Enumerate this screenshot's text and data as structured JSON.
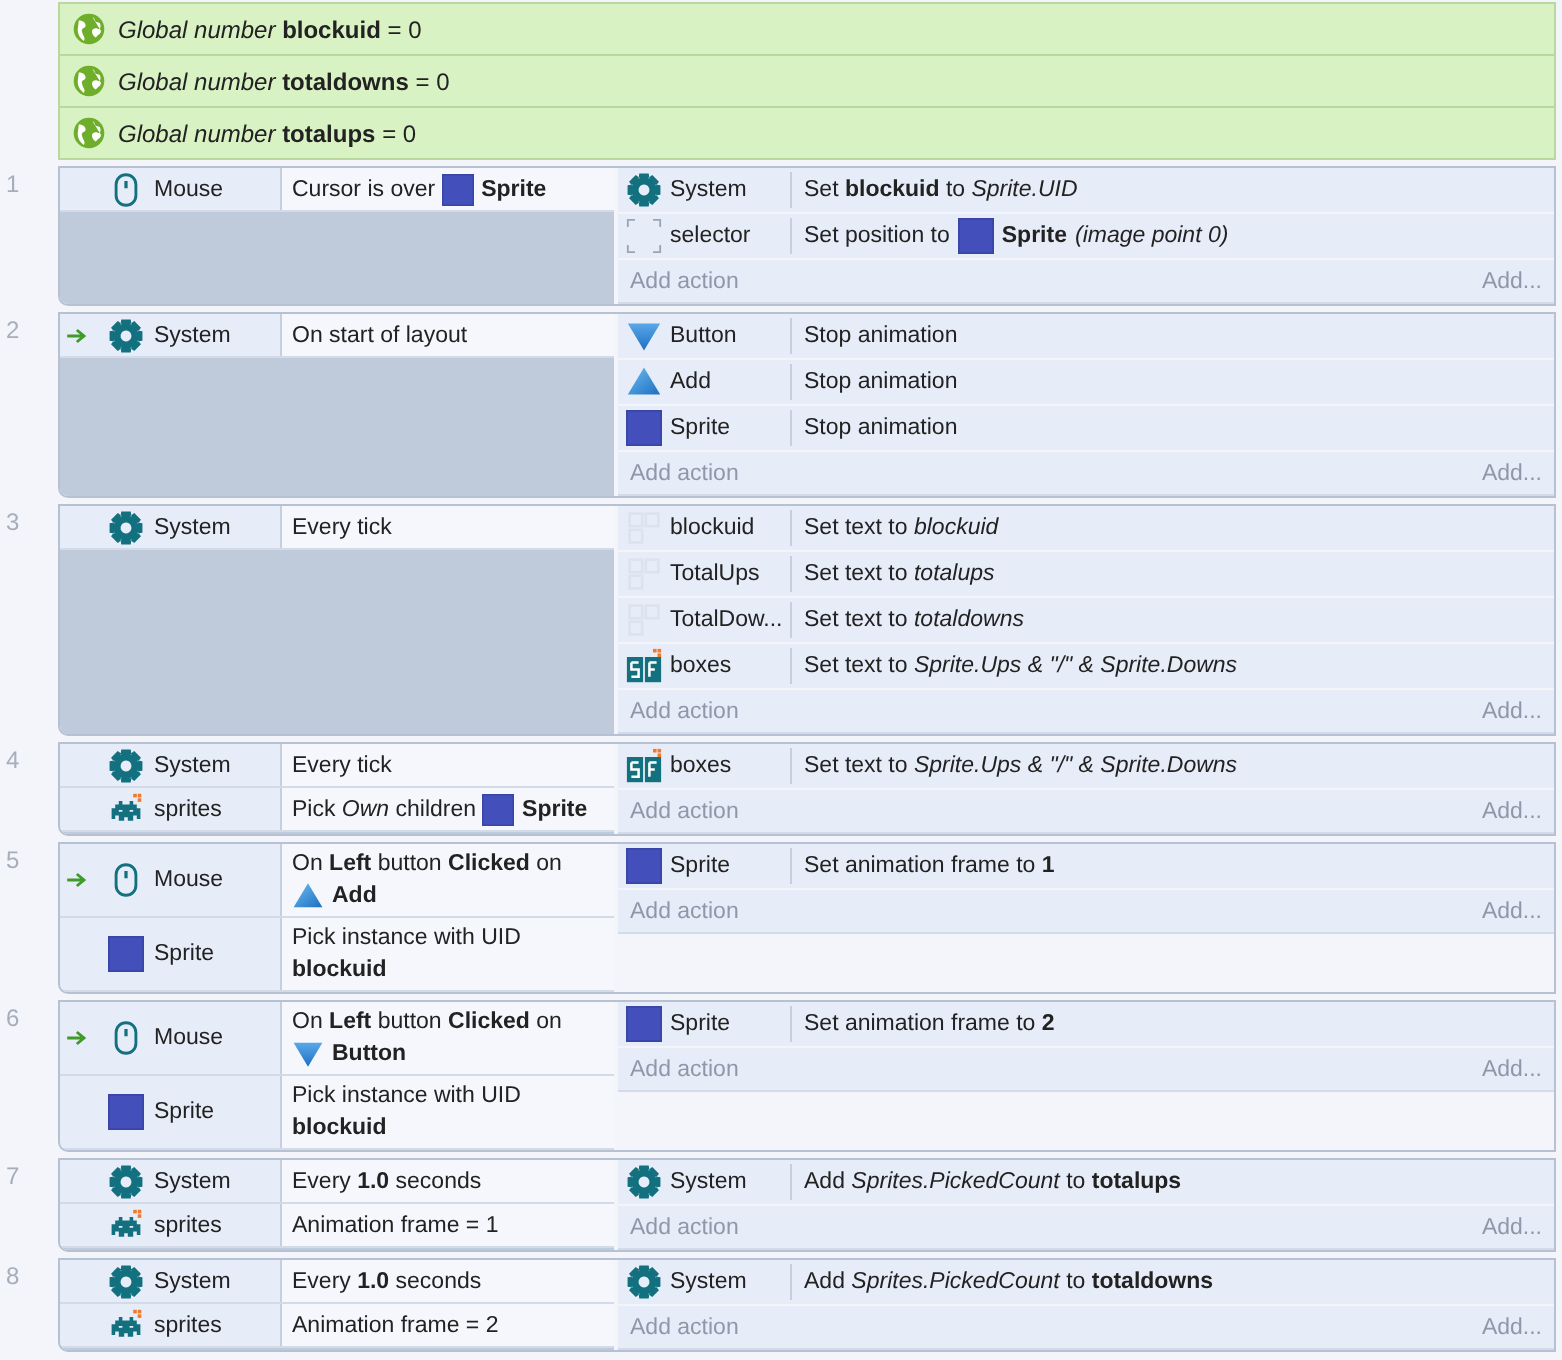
{
  "globals": [
    {
      "text": "*Global number* **blockuid** = 0"
    },
    {
      "text": "*Global number* **totaldowns** = 0"
    },
    {
      "text": "*Global number* **totalups** = 0"
    }
  ],
  "events": [
    {
      "number": "1",
      "trigger": false,
      "conditions": [
        {
          "kind": "mouse",
          "object": "Mouse",
          "text": "Cursor is over",
          "target": {
            "kind": "sprite",
            "name": "Sprite"
          }
        }
      ],
      "actions": [
        {
          "kind": "gear",
          "object": "System",
          "text": "Set **blockuid** to *Sprite.UID*"
        },
        {
          "kind": "selector",
          "object": "selector",
          "text": "Set position to",
          "target": {
            "kind": "sprite",
            "name": "Sprite"
          },
          "suffix": "*(image point 0)*"
        }
      ],
      "add_action": "Add action",
      "add_more": "Add..."
    },
    {
      "number": "2",
      "trigger": true,
      "conditions": [
        {
          "kind": "gear",
          "object": "System",
          "text": "On start of layout"
        }
      ],
      "actions": [
        {
          "kind": "button",
          "object": "Button",
          "text": "Stop animation"
        },
        {
          "kind": "add",
          "object": "Add",
          "text": "Stop animation"
        },
        {
          "kind": "sprite",
          "object": "Sprite",
          "text": "Stop animation"
        }
      ],
      "add_action": "Add action",
      "add_more": "Add..."
    },
    {
      "number": "3",
      "trigger": false,
      "conditions": [
        {
          "kind": "gear",
          "object": "System",
          "text": "Every tick"
        }
      ],
      "actions": [
        {
          "kind": "text",
          "object": "blockuid",
          "text": "Set text to *blockuid*"
        },
        {
          "kind": "text",
          "object": "TotalUps",
          "text": "Set text to *totalups*"
        },
        {
          "kind": "text",
          "object": "TotalDow...",
          "text": "Set text to *totaldowns*"
        },
        {
          "kind": "spritefont",
          "object": "boxes",
          "text": "Set text to *Sprite.Ups & \"/\" & Sprite.Downs*"
        }
      ],
      "add_action": "Add action",
      "add_more": "Add..."
    },
    {
      "number": "4",
      "trigger": false,
      "conditions": [
        {
          "kind": "gear",
          "object": "System",
          "text": "Every tick"
        },
        {
          "kind": "family",
          "object": "sprites",
          "text": "Pick *Own* children",
          "target": {
            "kind": "sprite",
            "name": "Sprite"
          }
        }
      ],
      "actions": [
        {
          "kind": "spritefont",
          "object": "boxes",
          "text": "Set text to *Sprite.Ups & \"/\" & Sprite.Downs*"
        }
      ],
      "add_action": "Add action",
      "add_more": "Add..."
    },
    {
      "number": "5",
      "trigger": true,
      "conditions": [
        {
          "kind": "mouse",
          "object": "Mouse",
          "text": "On **Left** button **Clicked** on",
          "target": {
            "kind": "add",
            "name": "Add"
          }
        },
        {
          "kind": "sprite",
          "object": "Sprite",
          "text": "Pick instance with UID **blockuid**"
        }
      ],
      "actions": [
        {
          "kind": "sprite",
          "object": "Sprite",
          "text": "Set animation frame to **1**"
        }
      ],
      "add_action": "Add action",
      "add_more": "Add..."
    },
    {
      "number": "6",
      "trigger": true,
      "conditions": [
        {
          "kind": "mouse",
          "object": "Mouse",
          "text": "On **Left** button **Clicked** on",
          "target": {
            "kind": "button",
            "name": "Button"
          }
        },
        {
          "kind": "sprite",
          "object": "Sprite",
          "text": "Pick instance with UID **blockuid**"
        }
      ],
      "actions": [
        {
          "kind": "sprite",
          "object": "Sprite",
          "text": "Set animation frame to **2**"
        }
      ],
      "add_action": "Add action",
      "add_more": "Add..."
    },
    {
      "number": "7",
      "trigger": false,
      "conditions": [
        {
          "kind": "gear",
          "object": "System",
          "text": "Every **1.0** seconds"
        },
        {
          "kind": "family",
          "object": "sprites",
          "text": "Animation frame = 1"
        }
      ],
      "actions": [
        {
          "kind": "gear",
          "object": "System",
          "text": "Add *Sprites.PickedCount* to **totalups**"
        }
      ],
      "add_action": "Add action",
      "add_more": "Add..."
    },
    {
      "number": "8",
      "trigger": false,
      "conditions": [
        {
          "kind": "gear",
          "object": "System",
          "text": "Every **1.0** seconds"
        },
        {
          "kind": "family",
          "object": "sprites",
          "text": "Animation frame = 2"
        }
      ],
      "actions": [
        {
          "kind": "gear",
          "object": "System",
          "text": "Add *Sprites.PickedCount* to **totaldowns**"
        }
      ],
      "add_action": "Add action",
      "add_more": "Add..."
    }
  ]
}
